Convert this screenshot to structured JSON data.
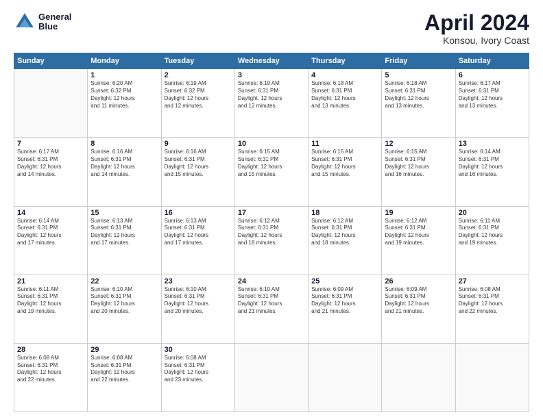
{
  "header": {
    "logo_line1": "General",
    "logo_line2": "Blue",
    "title": "April 2024",
    "subtitle": "Konsou, Ivory Coast"
  },
  "days_of_week": [
    "Sunday",
    "Monday",
    "Tuesday",
    "Wednesday",
    "Thursday",
    "Friday",
    "Saturday"
  ],
  "weeks": [
    [
      {
        "day": "",
        "info": ""
      },
      {
        "day": "1",
        "info": "Sunrise: 6:20 AM\nSunset: 6:32 PM\nDaylight: 12 hours\nand 11 minutes."
      },
      {
        "day": "2",
        "info": "Sunrise: 6:19 AM\nSunset: 6:32 PM\nDaylight: 12 hours\nand 12 minutes."
      },
      {
        "day": "3",
        "info": "Sunrise: 6:19 AM\nSunset: 6:31 PM\nDaylight: 12 hours\nand 12 minutes."
      },
      {
        "day": "4",
        "info": "Sunrise: 6:18 AM\nSunset: 6:31 PM\nDaylight: 12 hours\nand 13 minutes."
      },
      {
        "day": "5",
        "info": "Sunrise: 6:18 AM\nSunset: 6:31 PM\nDaylight: 12 hours\nand 13 minutes."
      },
      {
        "day": "6",
        "info": "Sunrise: 6:17 AM\nSunset: 6:31 PM\nDaylight: 12 hours\nand 13 minutes."
      }
    ],
    [
      {
        "day": "7",
        "info": "Sunrise: 6:17 AM\nSunset: 6:31 PM\nDaylight: 12 hours\nand 14 minutes."
      },
      {
        "day": "8",
        "info": "Sunrise: 6:16 AM\nSunset: 6:31 PM\nDaylight: 12 hours\nand 14 minutes."
      },
      {
        "day": "9",
        "info": "Sunrise: 6:16 AM\nSunset: 6:31 PM\nDaylight: 12 hours\nand 15 minutes."
      },
      {
        "day": "10",
        "info": "Sunrise: 6:15 AM\nSunset: 6:31 PM\nDaylight: 12 hours\nand 15 minutes."
      },
      {
        "day": "11",
        "info": "Sunrise: 6:15 AM\nSunset: 6:31 PM\nDaylight: 12 hours\nand 15 minutes."
      },
      {
        "day": "12",
        "info": "Sunrise: 6:15 AM\nSunset: 6:31 PM\nDaylight: 12 hours\nand 16 minutes."
      },
      {
        "day": "13",
        "info": "Sunrise: 6:14 AM\nSunset: 6:31 PM\nDaylight: 12 hours\nand 16 minutes."
      }
    ],
    [
      {
        "day": "14",
        "info": "Sunrise: 6:14 AM\nSunset: 6:31 PM\nDaylight: 12 hours\nand 17 minutes."
      },
      {
        "day": "15",
        "info": "Sunrise: 6:13 AM\nSunset: 6:31 PM\nDaylight: 12 hours\nand 17 minutes."
      },
      {
        "day": "16",
        "info": "Sunrise: 6:13 AM\nSunset: 6:31 PM\nDaylight: 12 hours\nand 17 minutes."
      },
      {
        "day": "17",
        "info": "Sunrise: 6:12 AM\nSunset: 6:31 PM\nDaylight: 12 hours\nand 18 minutes."
      },
      {
        "day": "18",
        "info": "Sunrise: 6:12 AM\nSunset: 6:31 PM\nDaylight: 12 hours\nand 18 minutes."
      },
      {
        "day": "19",
        "info": "Sunrise: 6:12 AM\nSunset: 6:31 PM\nDaylight: 12 hours\nand 19 minutes."
      },
      {
        "day": "20",
        "info": "Sunrise: 6:11 AM\nSunset: 6:31 PM\nDaylight: 12 hours\nand 19 minutes."
      }
    ],
    [
      {
        "day": "21",
        "info": "Sunrise: 6:11 AM\nSunset: 6:31 PM\nDaylight: 12 hours\nand 19 minutes."
      },
      {
        "day": "22",
        "info": "Sunrise: 6:10 AM\nSunset: 6:31 PM\nDaylight: 12 hours\nand 20 minutes."
      },
      {
        "day": "23",
        "info": "Sunrise: 6:10 AM\nSunset: 6:31 PM\nDaylight: 12 hours\nand 20 minutes."
      },
      {
        "day": "24",
        "info": "Sunrise: 6:10 AM\nSunset: 6:31 PM\nDaylight: 12 hours\nand 21 minutes."
      },
      {
        "day": "25",
        "info": "Sunrise: 6:09 AM\nSunset: 6:31 PM\nDaylight: 12 hours\nand 21 minutes."
      },
      {
        "day": "26",
        "info": "Sunrise: 6:09 AM\nSunset: 6:31 PM\nDaylight: 12 hours\nand 21 minutes."
      },
      {
        "day": "27",
        "info": "Sunrise: 6:08 AM\nSunset: 6:31 PM\nDaylight: 12 hours\nand 22 minutes."
      }
    ],
    [
      {
        "day": "28",
        "info": "Sunrise: 6:08 AM\nSunset: 6:31 PM\nDaylight: 12 hours\nand 22 minutes."
      },
      {
        "day": "29",
        "info": "Sunrise: 6:08 AM\nSunset: 6:31 PM\nDaylight: 12 hours\nand 22 minutes."
      },
      {
        "day": "30",
        "info": "Sunrise: 6:08 AM\nSunset: 6:31 PM\nDaylight: 12 hours\nand 23 minutes."
      },
      {
        "day": "",
        "info": ""
      },
      {
        "day": "",
        "info": ""
      },
      {
        "day": "",
        "info": ""
      },
      {
        "day": "",
        "info": ""
      }
    ]
  ]
}
